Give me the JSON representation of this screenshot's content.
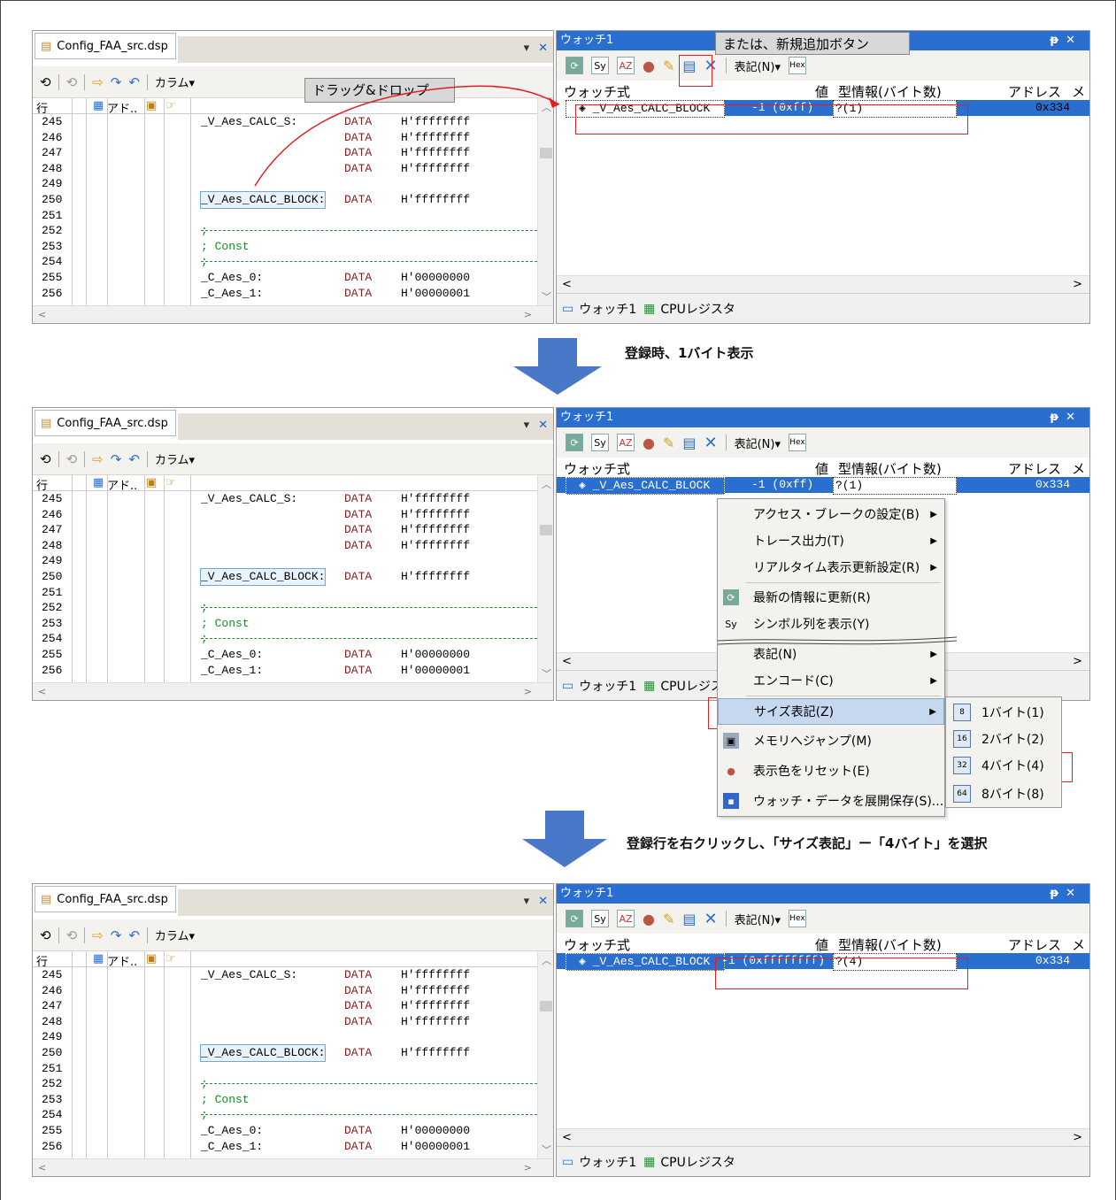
{
  "src": {
    "tab": "Config_FAA_src.dsp",
    "column_menu": "カラム▾",
    "col_row": "行",
    "col_addr": "アド..",
    "line_numbers": [
      "245",
      "246",
      "247",
      "248",
      "249",
      "250",
      "251",
      "252",
      "253",
      "254",
      "255",
      "256"
    ],
    "code": [
      {
        "label": "_V_Aes_CALC_S:",
        "kw": "DATA",
        "val": "H'ffffffff"
      },
      {
        "label": "",
        "kw": "DATA",
        "val": "H'ffffffff"
      },
      {
        "label": "",
        "kw": "DATA",
        "val": "H'ffffffff"
      },
      {
        "label": "",
        "kw": "DATA",
        "val": "H'ffffffff"
      },
      {
        "label": "",
        "kw": "",
        "val": ""
      },
      {
        "label": "_V_Aes_CALC_BLOCK:",
        "kw": "DATA",
        "val": "H'ffffffff"
      },
      {
        "label": "",
        "kw": "",
        "val": ""
      },
      {
        "label": ";",
        "kw": "",
        "val": ""
      },
      {
        "label": "; Const",
        "kw": "",
        "val": ""
      },
      {
        "label": ";",
        "kw": "",
        "val": ""
      },
      {
        "label": "_C_Aes_0:",
        "kw": "DATA",
        "val": "H'00000000"
      },
      {
        "label": "_C_Aes_1:",
        "kw": "DATA",
        "val": "H'00000001"
      }
    ]
  },
  "watch": {
    "title": "ウォッチ1",
    "pin": "ᵽ",
    "close": "✕",
    "notation_btn": "表記(N)▾",
    "hdr_expr": "ウォッチ式",
    "hdr_val": "値",
    "hdr_type": "型情報(バイト数)",
    "hdr_addr": "アドレス",
    "hdr_extra": "メ",
    "row_name": "_V_Aes_CALC_BLOCK",
    "tab_watch": "ウォッチ1",
    "tab_cpu": "CPUレジスタ",
    "p1": {
      "val": "-1 (0xff)",
      "type": "?(1)",
      "addr": "0x334"
    },
    "p2": {
      "val": "-1 (0xff)",
      "type": "?(1)",
      "addr": "0x334"
    },
    "p3": {
      "val": "-1 (0xffffffff)",
      "type": "?(4)",
      "addr": "0x334"
    }
  },
  "callouts": {
    "new_btn": "または、新規追加ボタン",
    "drag": "ドラッグ&ドロップ",
    "step1": "登録時、1バイト表示",
    "step2": "登録行を右クリックし、「サイズ表記」ー「4バイト」を選択"
  },
  "menu": {
    "items": [
      "アクセス・ブレークの設定(B)",
      "トレース出力(T)",
      "リアルタイム表示更新設定(R)",
      "最新の情報に更新(R)",
      "シンボル列を表示(Y)",
      "表記(N)",
      "エンコード(C)",
      "サイズ表記(Z)",
      "メモリへジャンプ(M)",
      "表示色をリセット(E)",
      "ウォッチ・データを展開保存(S)..."
    ]
  },
  "submenu": {
    "items": [
      "1バイト(1)",
      "2バイト(2)",
      "4バイト(4)",
      "8バイト(8)"
    ],
    "badges": [
      "8",
      "16",
      "32",
      "64"
    ]
  },
  "colors": {
    "accent": "#2a6ecf",
    "red": "#e02020",
    "arrow": "#4a78c8"
  }
}
